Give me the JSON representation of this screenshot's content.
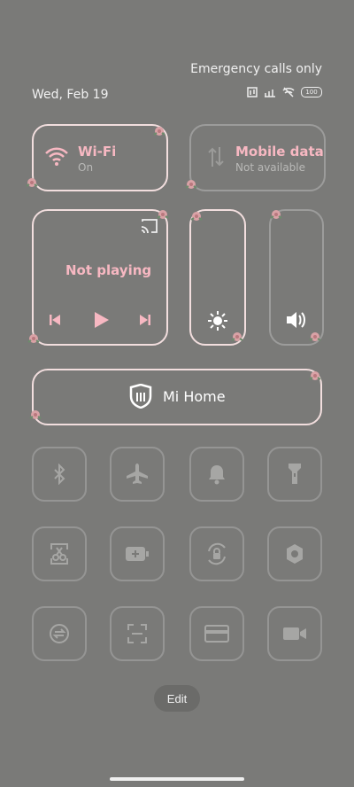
{
  "status": {
    "emergency": "Emergency calls only",
    "date": "Wed, Feb 19",
    "battery": "100"
  },
  "tiles": {
    "wifi": {
      "title": "Wi-Fi",
      "subtitle": "On"
    },
    "mobile": {
      "title": "Mobile data",
      "subtitle": "Not available"
    },
    "media": {
      "status": "Not playing"
    },
    "mihome": {
      "label": "Mi Home"
    }
  },
  "toggles": [
    {
      "icon": "bluetooth-icon"
    },
    {
      "icon": "airplane-icon"
    },
    {
      "icon": "bell-icon"
    },
    {
      "icon": "flashlight-icon"
    },
    {
      "icon": "screenshot-scissors-icon"
    },
    {
      "icon": "battery-saver-icon"
    },
    {
      "icon": "rotation-lock-icon"
    },
    {
      "icon": "hexagon-settings-icon"
    },
    {
      "icon": "sync-icon"
    },
    {
      "icon": "scan-icon"
    },
    {
      "icon": "card-icon"
    },
    {
      "icon": "video-camera-icon"
    }
  ],
  "edit_label": "Edit",
  "colors": {
    "accent": "#f7b8c2",
    "background": "#7a7a78"
  }
}
